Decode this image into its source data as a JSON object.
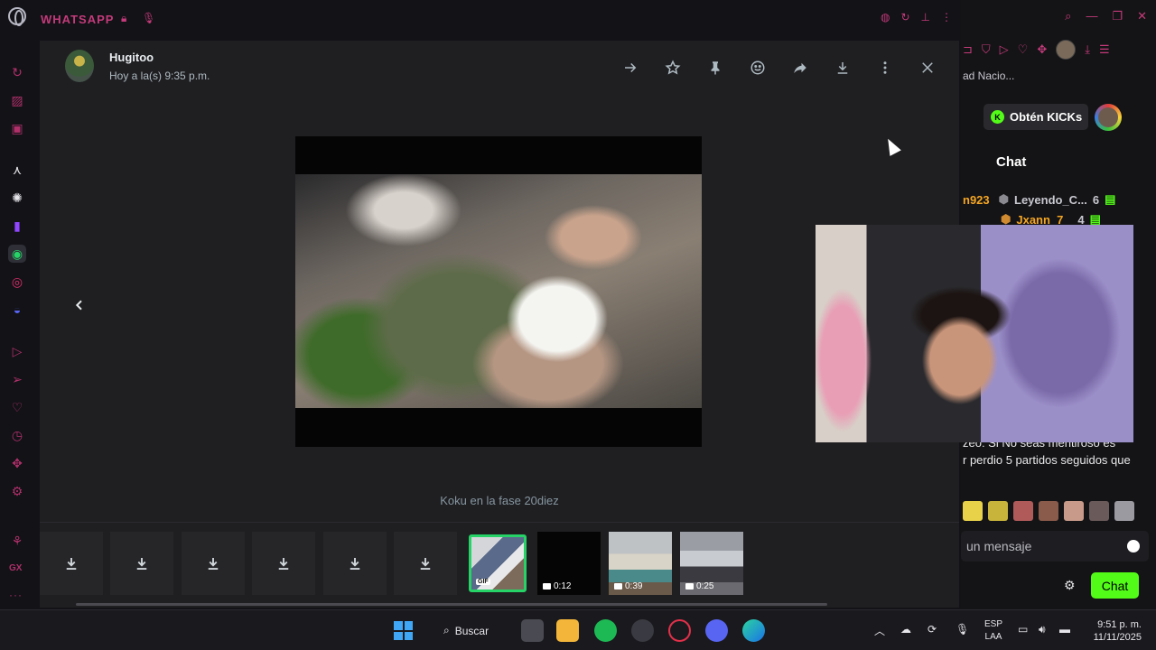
{
  "browser": {
    "panel_title": "WHATSAPP",
    "sidebar_icons": [
      "history-icon",
      "notes-icon",
      "messenger-icon",
      "aria-icon",
      "chatgpt-icon",
      "twitch-icon",
      "whatsapp-icon",
      "instagram-icon",
      "discord-icon",
      "player-icon",
      "send-icon",
      "heart-icon",
      "clock-icon",
      "extensions-icon",
      "settings-icon",
      "cleaner-icon"
    ],
    "gx_label": "GX",
    "more_label": "···"
  },
  "viewer": {
    "sender_name": "Hugitoo",
    "sent_time": "Hoy a la(s) 9:35 p.m.",
    "caption": "Koku en la fase 20diez",
    "toolbar": [
      "forward-arrow-icon",
      "star-icon",
      "pin-icon",
      "emoji-icon",
      "share-icon",
      "download-icon",
      "more-vertical-icon",
      "close-icon"
    ],
    "thumbnails": [
      {
        "kind": "download"
      },
      {
        "kind": "download"
      },
      {
        "kind": "download"
      },
      {
        "kind": "download"
      },
      {
        "kind": "download"
      },
      {
        "kind": "download"
      },
      {
        "kind": "gif",
        "label": "GIF",
        "selected": true
      },
      {
        "kind": "video",
        "duration": "0:12"
      },
      {
        "kind": "video",
        "duration": "0:39"
      },
      {
        "kind": "video",
        "duration": "0:25"
      }
    ]
  },
  "stream": {
    "bookmark_text": "ad Nacio...",
    "kicks_button": "Obtén KICKs",
    "chat_title": "Chat",
    "leaderboard": [
      {
        "left_name": "n923",
        "name": "Leyendo_C...",
        "count": "6"
      },
      {
        "name": "Jxann_7",
        "count": "4"
      }
    ],
    "messages": [
      "zeo: Si No seas mentiroso es",
      "r perdio 5 partidos seguidos que"
    ],
    "input_placeholder": "un mensaje",
    "chat_button": "Chat"
  },
  "taskbar": {
    "search_label": "Buscar",
    "lang_top": "ESP",
    "lang_bottom": "LAA",
    "time": "9:51 p. m.",
    "date": "11/11/2025"
  },
  "colors": {
    "accent": "#c43a7a",
    "kick_green": "#53fc18",
    "whatsapp_green": "#25d366",
    "viewer_bg": "#1f1f22"
  }
}
